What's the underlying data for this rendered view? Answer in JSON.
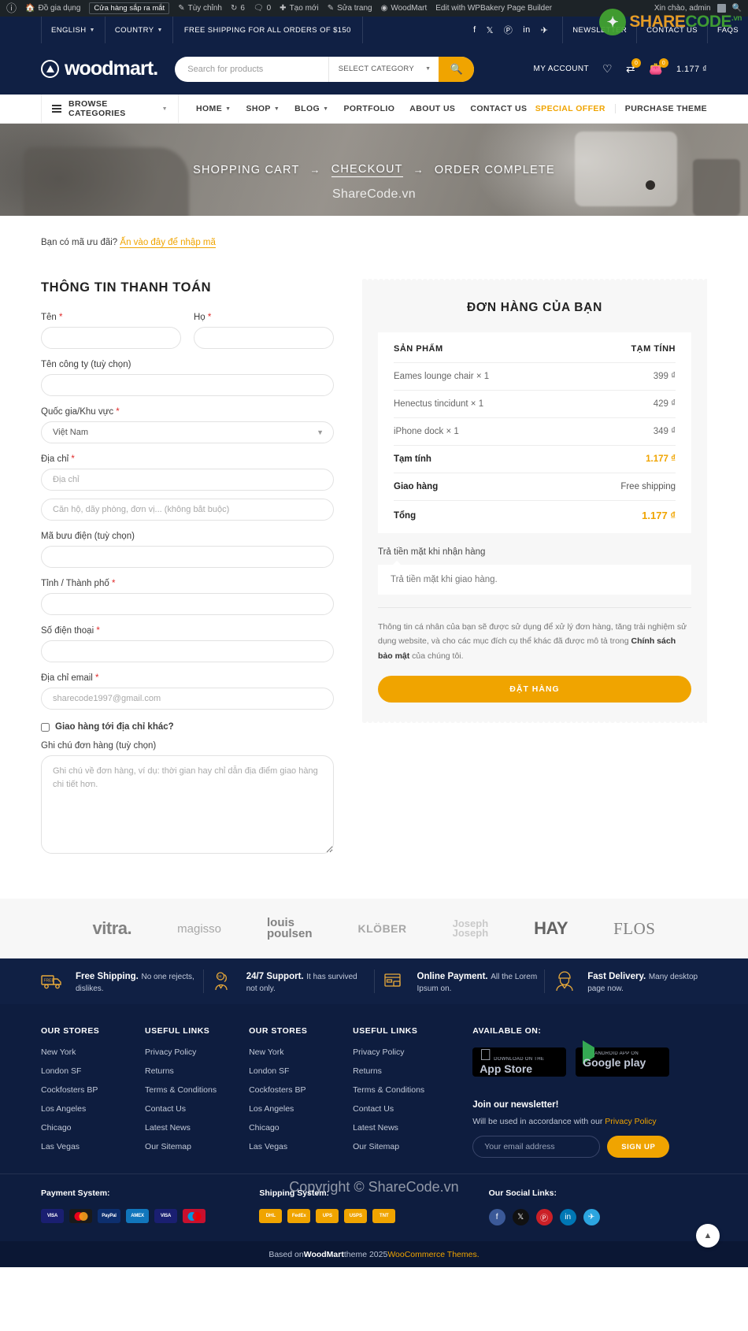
{
  "adminbar": {
    "wp_icon": "wordpress-icon",
    "site_name": "Đồ gia dụng",
    "coming_soon": "Cửa hàng sắp ra mắt",
    "customize": "Tùy chỉnh",
    "updates_count": "6",
    "comments_count": "0",
    "new": "Tạo mới",
    "edit_page": "Sửa trang",
    "woodmart": "WoodMart",
    "wpbakery": "Edit with WPBakery Page Builder",
    "greeting": "Xin chào, admin",
    "search_icon": "search-icon"
  },
  "topbar": {
    "language": "ENGLISH",
    "country": "COUNTRY",
    "shipping_note": "FREE SHIPPING FOR ALL ORDERS OF $150",
    "socials": [
      "facebook-icon",
      "x-icon",
      "pinterest-icon",
      "linkedin-icon",
      "telegram-icon"
    ],
    "links": [
      "NEWSLETTER",
      "CONTACT US",
      "FAQS"
    ]
  },
  "watermark": {
    "share": "SHARE",
    "code": "CODE",
    "vn": ".vn",
    "hero": "ShareCode.vn",
    "copyright": "Copyright © ShareCode.vn"
  },
  "header": {
    "logo_text": "woodmart.",
    "search_placeholder": "Search for products",
    "search_value": "",
    "select_category": "SELECT CATEGORY",
    "search_icon": "search-icon",
    "my_account": "MY ACCOUNT",
    "wishlist_icon": "heart-icon",
    "compare_icon": "compare-icon",
    "compare_badge": "0",
    "cart_icon": "cart-icon",
    "cart_badge": "0",
    "cart_total": "1.177 ₫"
  },
  "nav": {
    "browse_categories": "BROWSE CATEGORIES",
    "items": [
      "HOME",
      "SHOP",
      "BLOG",
      "PORTFOLIO",
      "ABOUT US",
      "CONTACT US"
    ],
    "items_with_caret": [
      "HOME",
      "SHOP",
      "BLOG"
    ],
    "special_offer": "SPECIAL OFFER",
    "purchase_theme": "PURCHASE THEME"
  },
  "breadcrumbs": {
    "step1": "SHOPPING CART",
    "step2": "CHECKOUT",
    "step3": "ORDER COMPLETE",
    "arrow": "→"
  },
  "checkout": {
    "coupon_text": "Bạn có mã ưu đãi?",
    "coupon_link": "Ấn vào đây để nhập mã",
    "billing_title": "THÔNG TIN THANH TOÁN",
    "fields": {
      "first_name_label": "Tên",
      "first_name_value": "",
      "last_name_label": "Họ",
      "last_name_value": "",
      "company_label": "Tên công ty (tuỳ chọn)",
      "company_value": "",
      "country_label": "Quốc gia/Khu vực",
      "country_value": "Việt Nam",
      "address_label": "Địa chỉ",
      "address_placeholder": "Địa chỉ",
      "address2_placeholder": "Căn hộ, dãy phòng, đơn vị... (không bắt buộc)",
      "postcode_label": "Mã bưu điện (tuỳ chọn)",
      "postcode_value": "",
      "city_label": "Tỉnh / Thành phố",
      "city_value": "",
      "phone_label": "Số điện thoại",
      "phone_value": "",
      "email_label": "Địa chỉ email",
      "email_placeholder": "sharecode1997@gmail.com",
      "ship_different_label": "Giao hàng tới địa chỉ khác?",
      "order_notes_label": "Ghi chú đơn hàng (tuỳ chọn)",
      "order_notes_placeholder": "Ghi chú về đơn hàng, ví dụ: thời gian hay chỉ dẫn địa điểm giao hàng chi tiết hơn."
    },
    "required_mark": "*"
  },
  "order": {
    "title": "ĐƠN HÀNG CỦA BẠN",
    "col_product": "SẢN PHẨM",
    "col_subtotal": "TẠM TÍNH",
    "items": [
      {
        "name": "Eames lounge chair × 1",
        "price": "399 ₫"
      },
      {
        "name": "Henectus tincidunt × 1",
        "price": "429 ₫"
      },
      {
        "name": "iPhone dock × 1",
        "price": "349 ₫"
      }
    ],
    "subtotal_label": "Tạm tính",
    "subtotal_value": "1.177 ₫",
    "shipping_label": "Giao hàng",
    "shipping_value": "Free shipping",
    "total_label": "Tổng",
    "total_value": "1.177 ₫",
    "payment_method_label": "Trả tiền mặt khi nhận hàng",
    "payment_method_desc": "Trả tiền mặt khi giao hàng.",
    "privacy_part1": "Thông tin cá nhân của bạn sẽ được sử dụng để xử lý đơn hàng, tăng trải nghiệm sử dụng website, và cho các mục đích cụ thể khác đã được mô tả trong ",
    "privacy_link": "Chính sách bảo mật",
    "privacy_part2": " của chúng tôi.",
    "place_order_button": "ĐẶT HÀNG",
    "accent_color": "#f0a400"
  },
  "brands": [
    {
      "name": "vitra.",
      "style": "b-vitra"
    },
    {
      "name": "magisso",
      "style": "b-magisso"
    },
    {
      "name": "louis poulsen",
      "style": "b-louis"
    },
    {
      "name": "KLÖBER",
      "style": "b-klober"
    },
    {
      "name": "Joseph Joseph",
      "style": "b-joseph"
    },
    {
      "name": "HAY",
      "style": "b-hay"
    },
    {
      "name": "FLOS",
      "style": "b-flos"
    }
  ],
  "features": [
    {
      "icon": "free-shipping-truck-icon",
      "title": "Free Shipping.",
      "desc": "No one rejects, dislikes."
    },
    {
      "icon": "support-headset-icon",
      "title": "24/7 Support.",
      "desc": "It has survived not only."
    },
    {
      "icon": "online-payment-card-icon",
      "title": "Online Payment.",
      "desc": "All the Lorem Ipsum on."
    },
    {
      "icon": "fast-delivery-worker-icon",
      "title": "Fast Delivery.",
      "desc": "Many desktop page now."
    }
  ],
  "footer": {
    "columns": [
      {
        "title": "OUR STORES",
        "links": [
          "New York",
          "London SF",
          "Cockfosters BP",
          "Los Angeles",
          "Chicago",
          "Las Vegas"
        ]
      },
      {
        "title": "USEFUL LINKS",
        "links": [
          "Privacy Policy",
          "Returns",
          "Terms & Conditions",
          "Contact Us",
          "Latest News",
          "Our Sitemap"
        ]
      },
      {
        "title": "OUR STORES",
        "links": [
          "New York",
          "London SF",
          "Cockfosters BP",
          "Los Angeles",
          "Chicago",
          "Las Vegas"
        ]
      },
      {
        "title": "USEFUL LINKS",
        "links": [
          "Privacy Policy",
          "Returns",
          "Terms & Conditions",
          "Contact Us",
          "Latest News",
          "Our Sitemap"
        ]
      }
    ],
    "available_on": "AVAILABLE ON:",
    "appstore_small": "Download on the",
    "appstore_big": "App Store",
    "googleplay_small": "ANDROID APP ON",
    "googleplay_big": "Google play",
    "newsletter_title": "Join our newsletter!",
    "newsletter_sub": "Will be used in accordance with our ",
    "newsletter_sub_link": "Privacy Policy",
    "newsletter_placeholder": "Your email address",
    "newsletter_value": "",
    "signup_button": "SIGN UP"
  },
  "paystrip": {
    "payment_title": "Payment System:",
    "payment_cards": [
      "VISA",
      "MC",
      "PayPal",
      "AMEX",
      "VISA",
      "Maestro"
    ],
    "shipping_title": "Shipping System:",
    "shipping_cards": [
      "DHL",
      "FedEx",
      "UPS",
      "USPS",
      "TNT"
    ],
    "social_title": "Our Social Links:",
    "social_icons": [
      "facebook-icon",
      "x-icon",
      "pinterest-icon",
      "linkedin-icon",
      "telegram-icon"
    ]
  },
  "bottombar": {
    "prefix": "Based on ",
    "brand": "WoodMart",
    "middle": " theme 2025 ",
    "suffix": "WooCommerce Themes.",
    "scroll_top_icon": "chevron-up-icon"
  }
}
